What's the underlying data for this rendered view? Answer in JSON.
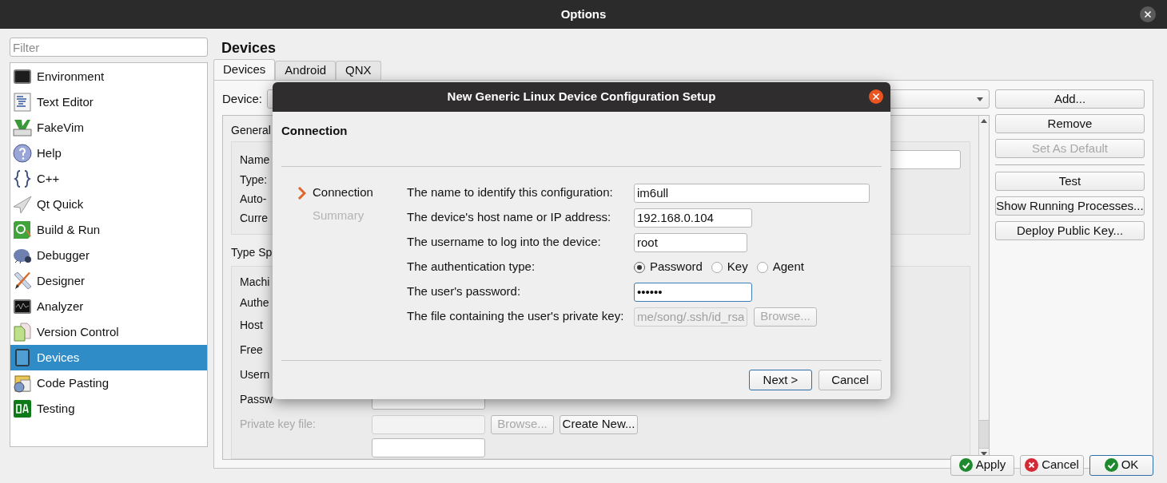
{
  "window": {
    "title": "Options"
  },
  "sidebar": {
    "filter": {
      "placeholder": "Filter"
    },
    "items": [
      {
        "label": "Environment",
        "selected": false
      },
      {
        "label": "Text Editor",
        "selected": false
      },
      {
        "label": "FakeVim",
        "selected": false
      },
      {
        "label": "Help",
        "selected": false
      },
      {
        "label": "C++",
        "selected": false
      },
      {
        "label": "Qt Quick",
        "selected": false
      },
      {
        "label": "Build & Run",
        "selected": false
      },
      {
        "label": "Debugger",
        "selected": false
      },
      {
        "label": "Designer",
        "selected": false
      },
      {
        "label": "Analyzer",
        "selected": false
      },
      {
        "label": "Version Control",
        "selected": false
      },
      {
        "label": "Devices",
        "selected": true
      },
      {
        "label": "Code Pasting",
        "selected": false
      },
      {
        "label": "Testing",
        "selected": false
      }
    ]
  },
  "page": {
    "title": "Devices",
    "tabs": [
      {
        "label": "Devices",
        "selected": true
      },
      {
        "label": "Android",
        "selected": false
      },
      {
        "label": "QNX",
        "selected": false
      }
    ],
    "device_label": "Device:",
    "general": {
      "title": "General",
      "labels": [
        "Name",
        "Type:",
        "Auto-",
        "Curre"
      ]
    },
    "type_specific": {
      "title": "Type Sp",
      "labels": [
        "Machi",
        "Authe",
        "Host",
        "Free",
        "Usern",
        "Passw"
      ],
      "private_key": {
        "label": "Private key file:",
        "disabled": true,
        "browse": "Browse...",
        "create_new": "Create New..."
      }
    },
    "button_groups": [
      [
        {
          "label": "Add...",
          "disabled": false
        },
        {
          "label": "Remove",
          "disabled": false
        },
        {
          "label": "Set As Default",
          "disabled": true
        }
      ],
      [
        {
          "label": "Test",
          "disabled": false
        },
        {
          "label": "Show Running Processes...",
          "disabled": false
        },
        {
          "label": "Deploy Public Key...",
          "disabled": false
        }
      ]
    ]
  },
  "footer_buttons": [
    {
      "label": "Apply",
      "kind": "apply",
      "default": false
    },
    {
      "label": "Cancel",
      "kind": "cancel",
      "default": false
    },
    {
      "label": "OK",
      "kind": "ok",
      "default": true
    }
  ],
  "dialog": {
    "title": "New Generic Linux Device Configuration Setup",
    "page_title": "Connection",
    "steps": [
      {
        "label": "Connection",
        "selected": true
      },
      {
        "label": "Summary",
        "selected": false
      }
    ],
    "fields": [
      {
        "kind": "text",
        "label": "The name to identify this configuration:",
        "value": "im6ull",
        "focused": false
      },
      {
        "kind": "text",
        "label": "The device's host name or IP address:",
        "value": "192.168.0.104",
        "focused": false
      },
      {
        "kind": "text",
        "label": "The username to log into the device:",
        "value": "root",
        "focused": false
      },
      {
        "kind": "radio",
        "label": "The authentication type:",
        "options": [
          {
            "label": "Password",
            "selected": true
          },
          {
            "label": "Key",
            "selected": false
          },
          {
            "label": "Agent",
            "selected": false
          }
        ]
      },
      {
        "kind": "text",
        "label": "The user's password:",
        "value": "••••••",
        "focused": true
      },
      {
        "kind": "file",
        "label": "The file containing the user's private key:",
        "value": "me/song/.ssh/id_rsa",
        "disabled": true,
        "button": "Browse..."
      }
    ],
    "buttons": [
      {
        "label": "Next >",
        "default": true
      },
      {
        "label": "Cancel",
        "default": false
      }
    ]
  }
}
